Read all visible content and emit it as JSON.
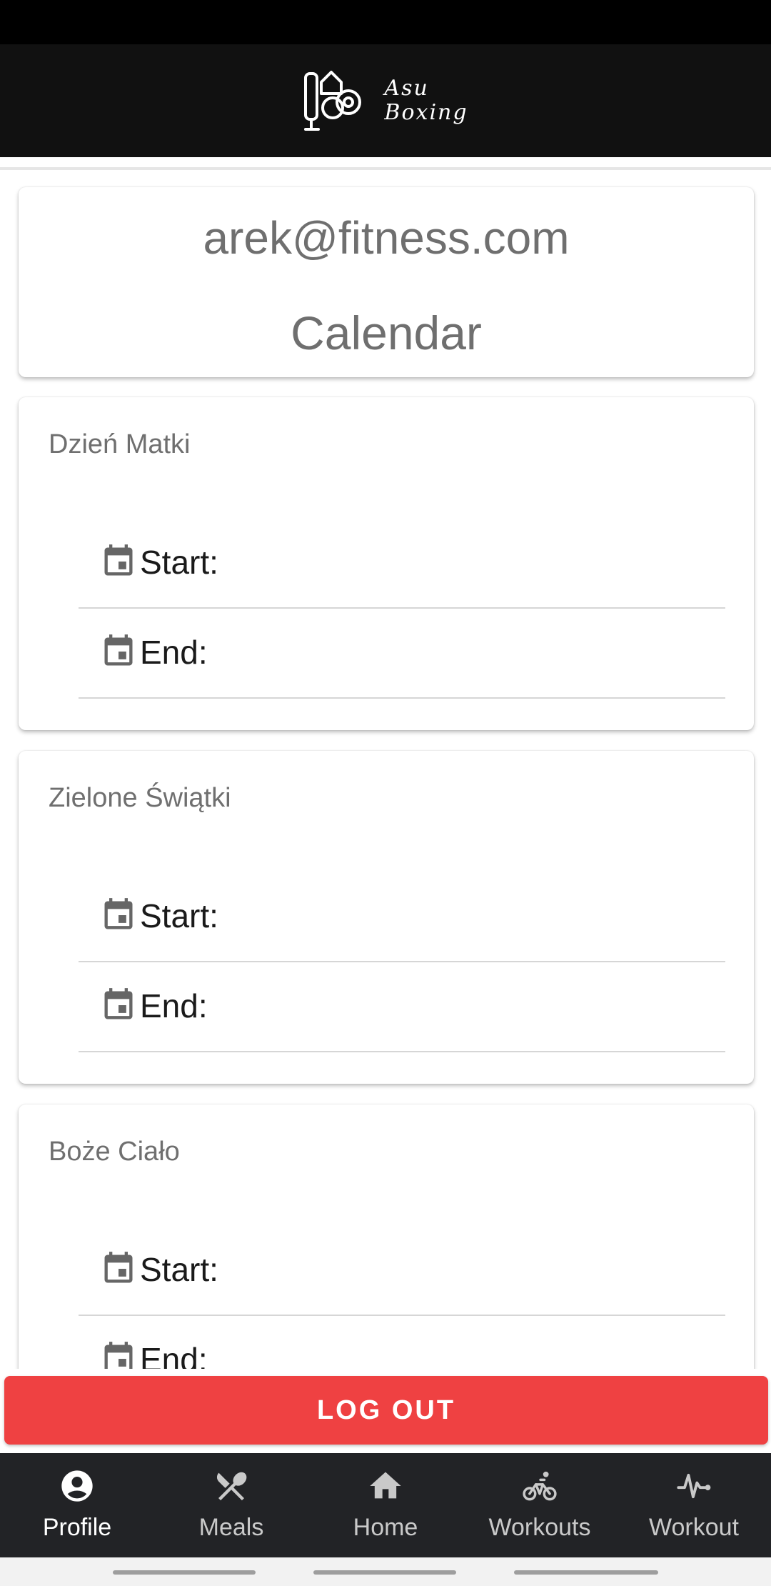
{
  "brand": {
    "line1": "Asu",
    "line2": "Boxing"
  },
  "profile": {
    "email": "arek@fitness.com",
    "title": "Calendar"
  },
  "events": [
    {
      "name": "Dzień Matki",
      "start_label": "Start:",
      "end_label": "End:"
    },
    {
      "name": "Zielone Świątki",
      "start_label": "Start:",
      "end_label": "End:"
    },
    {
      "name": "Boże Ciało",
      "start_label": "Start:",
      "end_label": "End:"
    }
  ],
  "logout": {
    "label": "LOG OUT",
    "color": "#ef4142"
  },
  "nav": {
    "items": [
      {
        "label": "Profile",
        "icon": "profile-icon",
        "active": true
      },
      {
        "label": "Meals",
        "icon": "cutlery-icon",
        "active": false
      },
      {
        "label": "Home",
        "icon": "home-icon",
        "active": false
      },
      {
        "label": "Workouts",
        "icon": "bicycle-icon",
        "active": false
      },
      {
        "label": "Workout",
        "icon": "pulse-icon",
        "active": false
      }
    ]
  },
  "colors": {
    "header": "#111111",
    "nav_bg": "#222326",
    "accent": "#ef4142"
  }
}
